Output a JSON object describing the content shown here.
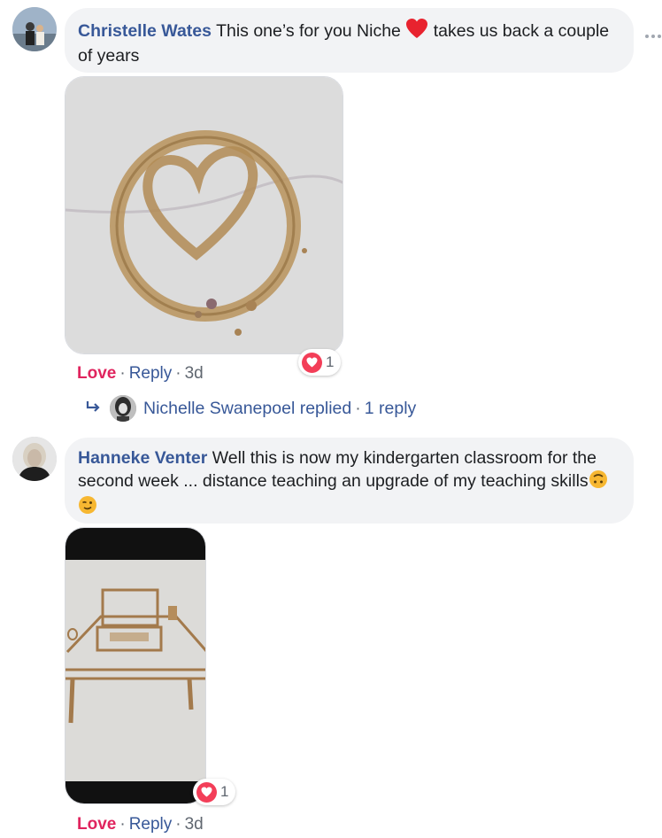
{
  "comments": [
    {
      "author": "Christelle Wates",
      "text_before": "This one’s for you Niche",
      "emoji": "red-heart",
      "text_after": "takes us back a couple of years",
      "reaction_count": "1",
      "actions": {
        "love": "Love",
        "reply": "Reply",
        "age": "3d"
      },
      "replies": {
        "replier": "Nichelle Swanepoel",
        "replied_label": "replied",
        "reply_count": "1 reply"
      }
    },
    {
      "author": "Hanneke Venter",
      "text": "Well this is now my kindergarten classroom for the second week ... distance teaching an upgrade of my teaching skills",
      "emojis": [
        "upside-down-face",
        "winking-face"
      ],
      "reaction_count": "1",
      "actions": {
        "love": "Love",
        "reply": "Reply",
        "age": "3d"
      }
    }
  ],
  "separator": "·",
  "colors": {
    "author": "#385898",
    "love": "#e0245e",
    "bubble": "#f2f3f5",
    "meta": "#606770"
  }
}
